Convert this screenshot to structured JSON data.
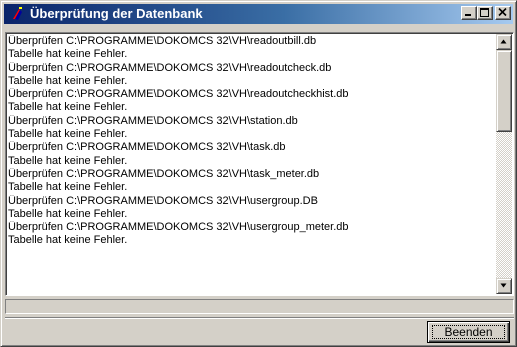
{
  "window": {
    "title": "Überprüfung der Datenbank",
    "title_colors": {
      "start": "#0a246a",
      "end": "#a6caf0"
    }
  },
  "titlebar_buttons": [
    {
      "name": "minimize",
      "icon": "minimize-icon"
    },
    {
      "name": "maximize",
      "icon": "maximize-icon"
    },
    {
      "name": "close",
      "icon": "close-icon"
    }
  ],
  "log": {
    "lines": [
      "Überprüfen C:\\PROGRAMME\\DOKOMCS 32\\VH\\readoutbill.db",
      "Tabelle hat keine Fehler.",
      "Überprüfen C:\\PROGRAMME\\DOKOMCS 32\\VH\\readoutcheck.db",
      "Tabelle hat keine Fehler.",
      "Überprüfen C:\\PROGRAMME\\DOKOMCS 32\\VH\\readoutcheckhist.db",
      "Tabelle hat keine Fehler.",
      "Überprüfen C:\\PROGRAMME\\DOKOMCS 32\\VH\\station.db",
      "Tabelle hat keine Fehler.",
      "Überprüfen C:\\PROGRAMME\\DOKOMCS 32\\VH\\task.db",
      "Tabelle hat keine Fehler.",
      "Überprüfen C:\\PROGRAMME\\DOKOMCS 32\\VH\\task_meter.db",
      "Tabelle hat keine Fehler.",
      "Überprüfen C:\\PROGRAMME\\DOKOMCS 32\\VH\\usergroup.DB",
      "Tabelle hat keine Fehler.",
      "Überprüfen C:\\PROGRAMME\\DOKOMCS 32\\VH\\usergroup_meter.db",
      "Tabelle hat keine Fehler."
    ]
  },
  "scrollbar": {
    "up_icon": "scroll-up-arrow-icon",
    "down_icon": "scroll-down-arrow-icon",
    "position": "bottom"
  },
  "progress": {
    "value": 0
  },
  "footer": {
    "close_label": "Beenden"
  }
}
